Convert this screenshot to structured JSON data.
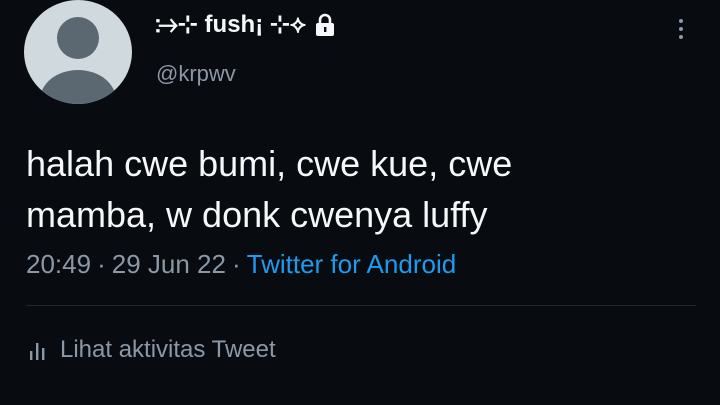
{
  "profile": {
    "display_name": "⧴⊹ fush¡ ⊹⟡",
    "handle": "@krpwv",
    "avatar_icon": "default-avatar-icon",
    "lock_icon": "lock-icon"
  },
  "menu": {
    "more_icon": "more-vertical-icon"
  },
  "tweet": {
    "text_lines": [
      "halah cwe bumi, cwe kue, cwe",
      "mamba, w donk cwenya luffy"
    ],
    "time": "20:49",
    "separator": "·",
    "date": "29 Jun 22",
    "source": "Twitter for Android"
  },
  "activity": {
    "icon": "analytics-bar-icon",
    "label": "Lihat aktivitas Tweet"
  },
  "colors": {
    "background": "#080b10",
    "text": "#f5f7f8",
    "muted": "#8b98a5",
    "link": "#1d9bf0",
    "avatar_bg": "#cfd9de",
    "avatar_fg": "#5b6771"
  }
}
